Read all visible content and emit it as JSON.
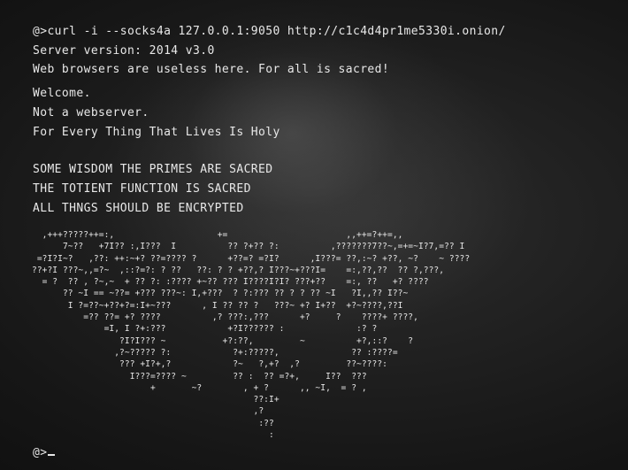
{
  "terminal": {
    "command_line": "@>curl -i --socks4a 127.0.0.1:9050 http://c1c4d4pr1me5330i.onion/",
    "server_version": "Server version: 2014 v3.0",
    "browser_notice": "Web browsers are useless here. For all is sacred!",
    "welcome": "Welcome.",
    "not_webserver": "Not a webserver.",
    "holy_line": "For Every Thing That Lives Is Holy",
    "wisdom_1": "SOME WISDOM THE PRIMES ARE SACRED",
    "wisdom_2": "THE TOTIENT FUNCTION IS SACRED",
    "wisdom_3": "ALL THNGS SHOULD BE ENCRYPTED",
    "ascii_art": "  ,+++?????++=:,                    +=                       ,,++=?++=,,\n      7~??   +7I?? :,I???  I          ?? ?+?? ?:          ,???????7??~,=+=~I?7,=?? I\n =?I?I~?   ,??: ++:~+? ??=???? ?      +??=? =?I?      ,I???= ??,:~? +??, ~?    ~ ????\n??+?I ???~,,=?~  ,::?=?: ? ??   ??: ? ? +??,? I???~+???I=    =:,??,??  ?? ?,???,\n  = ?  ?? , ?~,~  + ?? ?: :???? +~?? ??? I????I?I? ???+??    =:, ??   +? ????\n      ?? ~I == ~??= +??? ???~: I,+???  ? ?:??? ?? ? ? ?? ~I   ?I,,?? I??~\n       I ?=??~+??+?=:I+~???      , I ?? ?? ?   ???~ +? I+??  +?~????,??I\n          =?? ??= +? ????          ,? ???:,???      +?     ?    ????+ ????,\n              =I, I ?+:???            +?I?????? :              :? ?\n                 ?I?I??? ~           +?:??,         ~          +?,::?    ?\n                ,?~????? ?:            ?+:?????,              ?? :????=\n                 ??? +I?+,?            ?~   ?,+?  ,?         ??~????:\n                   I???=???? ~         ?? :  ?? =?+,     I??  ???\n                       +       ~?        , + ?      ,, ~I,  = ? ,\n                                           ??:I+\n                                           ,?\n                                            :??\n                                              :",
    "prompt": "@>"
  }
}
